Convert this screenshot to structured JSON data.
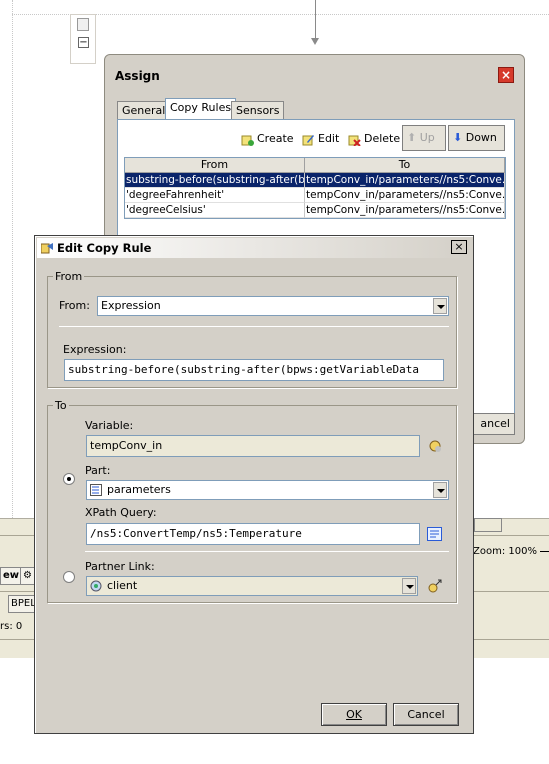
{
  "background": {
    "bottom_strip": {
      "button_view_label": "ew",
      "bpel_label": "BPEL",
      "errors_text": "rs: 0",
      "zoom_text": "Zoom: 100%"
    }
  },
  "assign_dialog": {
    "title": "Assign",
    "tabs": [
      "General",
      "Copy Rules",
      "Sensors"
    ],
    "active_tab": "Copy Rules",
    "toolbar": {
      "create_label": "Create",
      "edit_label": "Edit",
      "delete_label": "Delete",
      "up_label": "Up",
      "down_label": "Down"
    },
    "grid": {
      "columns": [
        "From",
        "To"
      ],
      "rows": [
        {
          "from": "substring-before(substring-after(b...",
          "to": "tempConv_in/parameters//ns5:Conve...",
          "selected": true
        },
        {
          "from": "'degreeFahrenheit'",
          "to": "tempConv_in/parameters//ns5:Conve...",
          "selected": false
        },
        {
          "from": "'degreeCelsius'",
          "to": "tempConv_in/parameters//ns5:Conve...",
          "selected": false
        }
      ]
    },
    "cancel_label": "ancel"
  },
  "edit_copy_rule_dialog": {
    "title": "Edit Copy Rule",
    "from_group": {
      "legend": "From",
      "from_label": "From:",
      "from_value": "Expression",
      "expression_label": "Expression:",
      "expression_value": "substring-before(substring-after(bpws:getVariableData"
    },
    "to_group": {
      "legend": "To",
      "variable_label": "Variable:",
      "variable_value": "tempConv_in",
      "part_label": "Part:",
      "part_value": "parameters",
      "part_selected": true,
      "xpath_label": "XPath Query:",
      "xpath_value": "/ns5:ConvertTemp/ns5:Temperature",
      "partner_link_label": "Partner Link:",
      "partner_link_value": "client",
      "partner_link_selected": false
    },
    "ok_label": "OK",
    "cancel_label": "Cancel"
  },
  "colors": {
    "dialog_bg": "#d4d0c8",
    "selection": "#0a246a",
    "close_red": "#d63a2c"
  }
}
